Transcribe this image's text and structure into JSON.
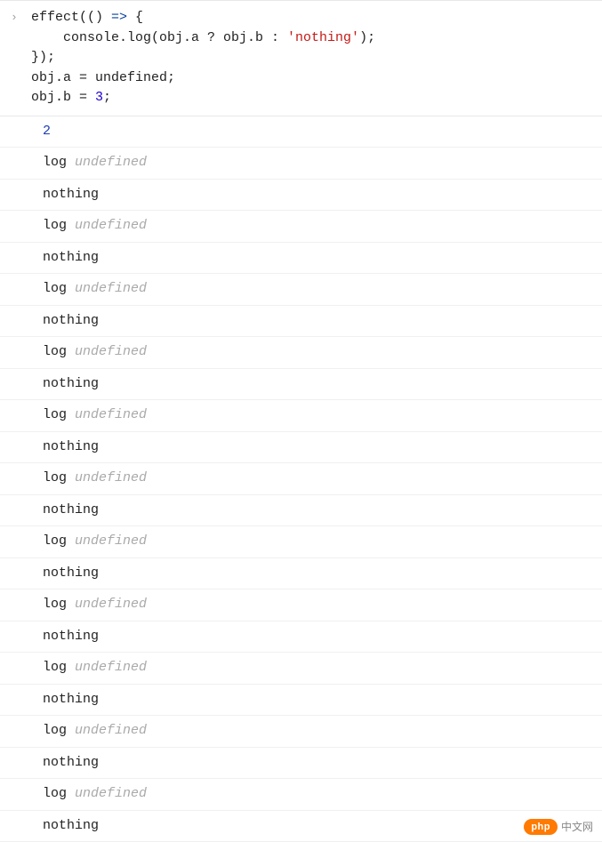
{
  "input": {
    "marker": "›",
    "lines": [
      {
        "segments": [
          {
            "text": "effect(() ",
            "cls": ""
          },
          {
            "text": "=>",
            "cls": "tok-arrow"
          },
          {
            "text": " {",
            "cls": ""
          }
        ]
      },
      {
        "segments": [
          {
            "text": "    console.log(obj.a ? obj.b : ",
            "cls": ""
          },
          {
            "text": "'nothing'",
            "cls": "tok-string"
          },
          {
            "text": ");",
            "cls": ""
          }
        ]
      },
      {
        "segments": [
          {
            "text": "});",
            "cls": ""
          }
        ]
      },
      {
        "segments": [
          {
            "text": "obj.a = ",
            "cls": ""
          },
          {
            "text": "undefined",
            "cls": "tok-undef"
          },
          {
            "text": ";",
            "cls": ""
          }
        ]
      },
      {
        "segments": [
          {
            "text": "obj.b = ",
            "cls": ""
          },
          {
            "text": "3",
            "cls": "tok-num"
          },
          {
            "text": ";",
            "cls": ""
          }
        ]
      }
    ]
  },
  "result": "2",
  "log_entries": [
    {
      "type": "log-undef",
      "label": "log",
      "value": "undefined"
    },
    {
      "type": "plain",
      "text": "nothing"
    },
    {
      "type": "log-undef",
      "label": "log",
      "value": "undefined"
    },
    {
      "type": "plain",
      "text": "nothing"
    },
    {
      "type": "log-undef",
      "label": "log",
      "value": "undefined"
    },
    {
      "type": "plain",
      "text": "nothing"
    },
    {
      "type": "log-undef",
      "label": "log",
      "value": "undefined"
    },
    {
      "type": "plain",
      "text": "nothing"
    },
    {
      "type": "log-undef",
      "label": "log",
      "value": "undefined"
    },
    {
      "type": "plain",
      "text": "nothing"
    },
    {
      "type": "log-undef",
      "label": "log",
      "value": "undefined"
    },
    {
      "type": "plain",
      "text": "nothing"
    },
    {
      "type": "log-undef",
      "label": "log",
      "value": "undefined"
    },
    {
      "type": "plain",
      "text": "nothing"
    },
    {
      "type": "log-undef",
      "label": "log",
      "value": "undefined"
    },
    {
      "type": "plain",
      "text": "nothing"
    },
    {
      "type": "log-undef",
      "label": "log",
      "value": "undefined"
    },
    {
      "type": "plain",
      "text": "nothing"
    },
    {
      "type": "log-undef",
      "label": "log",
      "value": "undefined"
    },
    {
      "type": "plain",
      "text": "nothing"
    },
    {
      "type": "log-undef",
      "label": "log",
      "value": "undefined"
    },
    {
      "type": "plain",
      "text": "nothing"
    }
  ],
  "watermark": {
    "pill": "php",
    "text": "中文网"
  }
}
